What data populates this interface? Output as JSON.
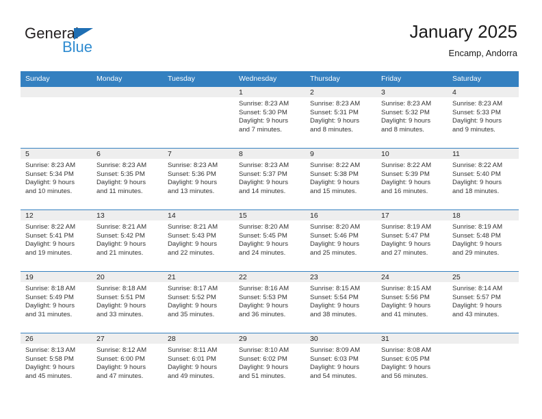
{
  "brand": {
    "word1": "General",
    "word2": "Blue",
    "triangle_color": "#1f6fb4",
    "blue_color": "#2e8bd0"
  },
  "header": {
    "title": "January 2025",
    "location": "Encamp, Andorra"
  },
  "colors": {
    "header_blue": "#3480c0",
    "daynum_band": "#eeeeee",
    "text": "#333333"
  },
  "weekday_headers": [
    "Sunday",
    "Monday",
    "Tuesday",
    "Wednesday",
    "Thursday",
    "Friday",
    "Saturday"
  ],
  "weeks": [
    [
      {
        "day": "",
        "lines": []
      },
      {
        "day": "",
        "lines": []
      },
      {
        "day": "",
        "lines": []
      },
      {
        "day": "1",
        "lines": [
          "Sunrise: 8:23 AM",
          "Sunset: 5:30 PM",
          "Daylight: 9 hours",
          "and 7 minutes."
        ]
      },
      {
        "day": "2",
        "lines": [
          "Sunrise: 8:23 AM",
          "Sunset: 5:31 PM",
          "Daylight: 9 hours",
          "and 8 minutes."
        ]
      },
      {
        "day": "3",
        "lines": [
          "Sunrise: 8:23 AM",
          "Sunset: 5:32 PM",
          "Daylight: 9 hours",
          "and 8 minutes."
        ]
      },
      {
        "day": "4",
        "lines": [
          "Sunrise: 8:23 AM",
          "Sunset: 5:33 PM",
          "Daylight: 9 hours",
          "and 9 minutes."
        ]
      }
    ],
    [
      {
        "day": "5",
        "lines": [
          "Sunrise: 8:23 AM",
          "Sunset: 5:34 PM",
          "Daylight: 9 hours",
          "and 10 minutes."
        ]
      },
      {
        "day": "6",
        "lines": [
          "Sunrise: 8:23 AM",
          "Sunset: 5:35 PM",
          "Daylight: 9 hours",
          "and 11 minutes."
        ]
      },
      {
        "day": "7",
        "lines": [
          "Sunrise: 8:23 AM",
          "Sunset: 5:36 PM",
          "Daylight: 9 hours",
          "and 13 minutes."
        ]
      },
      {
        "day": "8",
        "lines": [
          "Sunrise: 8:23 AM",
          "Sunset: 5:37 PM",
          "Daylight: 9 hours",
          "and 14 minutes."
        ]
      },
      {
        "day": "9",
        "lines": [
          "Sunrise: 8:22 AM",
          "Sunset: 5:38 PM",
          "Daylight: 9 hours",
          "and 15 minutes."
        ]
      },
      {
        "day": "10",
        "lines": [
          "Sunrise: 8:22 AM",
          "Sunset: 5:39 PM",
          "Daylight: 9 hours",
          "and 16 minutes."
        ]
      },
      {
        "day": "11",
        "lines": [
          "Sunrise: 8:22 AM",
          "Sunset: 5:40 PM",
          "Daylight: 9 hours",
          "and 18 minutes."
        ]
      }
    ],
    [
      {
        "day": "12",
        "lines": [
          "Sunrise: 8:22 AM",
          "Sunset: 5:41 PM",
          "Daylight: 9 hours",
          "and 19 minutes."
        ]
      },
      {
        "day": "13",
        "lines": [
          "Sunrise: 8:21 AM",
          "Sunset: 5:42 PM",
          "Daylight: 9 hours",
          "and 21 minutes."
        ]
      },
      {
        "day": "14",
        "lines": [
          "Sunrise: 8:21 AM",
          "Sunset: 5:43 PM",
          "Daylight: 9 hours",
          "and 22 minutes."
        ]
      },
      {
        "day": "15",
        "lines": [
          "Sunrise: 8:20 AM",
          "Sunset: 5:45 PM",
          "Daylight: 9 hours",
          "and 24 minutes."
        ]
      },
      {
        "day": "16",
        "lines": [
          "Sunrise: 8:20 AM",
          "Sunset: 5:46 PM",
          "Daylight: 9 hours",
          "and 25 minutes."
        ]
      },
      {
        "day": "17",
        "lines": [
          "Sunrise: 8:19 AM",
          "Sunset: 5:47 PM",
          "Daylight: 9 hours",
          "and 27 minutes."
        ]
      },
      {
        "day": "18",
        "lines": [
          "Sunrise: 8:19 AM",
          "Sunset: 5:48 PM",
          "Daylight: 9 hours",
          "and 29 minutes."
        ]
      }
    ],
    [
      {
        "day": "19",
        "lines": [
          "Sunrise: 8:18 AM",
          "Sunset: 5:49 PM",
          "Daylight: 9 hours",
          "and 31 minutes."
        ]
      },
      {
        "day": "20",
        "lines": [
          "Sunrise: 8:18 AM",
          "Sunset: 5:51 PM",
          "Daylight: 9 hours",
          "and 33 minutes."
        ]
      },
      {
        "day": "21",
        "lines": [
          "Sunrise: 8:17 AM",
          "Sunset: 5:52 PM",
          "Daylight: 9 hours",
          "and 35 minutes."
        ]
      },
      {
        "day": "22",
        "lines": [
          "Sunrise: 8:16 AM",
          "Sunset: 5:53 PM",
          "Daylight: 9 hours",
          "and 36 minutes."
        ]
      },
      {
        "day": "23",
        "lines": [
          "Sunrise: 8:15 AM",
          "Sunset: 5:54 PM",
          "Daylight: 9 hours",
          "and 38 minutes."
        ]
      },
      {
        "day": "24",
        "lines": [
          "Sunrise: 8:15 AM",
          "Sunset: 5:56 PM",
          "Daylight: 9 hours",
          "and 41 minutes."
        ]
      },
      {
        "day": "25",
        "lines": [
          "Sunrise: 8:14 AM",
          "Sunset: 5:57 PM",
          "Daylight: 9 hours",
          "and 43 minutes."
        ]
      }
    ],
    [
      {
        "day": "26",
        "lines": [
          "Sunrise: 8:13 AM",
          "Sunset: 5:58 PM",
          "Daylight: 9 hours",
          "and 45 minutes."
        ]
      },
      {
        "day": "27",
        "lines": [
          "Sunrise: 8:12 AM",
          "Sunset: 6:00 PM",
          "Daylight: 9 hours",
          "and 47 minutes."
        ]
      },
      {
        "day": "28",
        "lines": [
          "Sunrise: 8:11 AM",
          "Sunset: 6:01 PM",
          "Daylight: 9 hours",
          "and 49 minutes."
        ]
      },
      {
        "day": "29",
        "lines": [
          "Sunrise: 8:10 AM",
          "Sunset: 6:02 PM",
          "Daylight: 9 hours",
          "and 51 minutes."
        ]
      },
      {
        "day": "30",
        "lines": [
          "Sunrise: 8:09 AM",
          "Sunset: 6:03 PM",
          "Daylight: 9 hours",
          "and 54 minutes."
        ]
      },
      {
        "day": "31",
        "lines": [
          "Sunrise: 8:08 AM",
          "Sunset: 6:05 PM",
          "Daylight: 9 hours",
          "and 56 minutes."
        ]
      },
      {
        "day": "",
        "lines": []
      }
    ]
  ]
}
